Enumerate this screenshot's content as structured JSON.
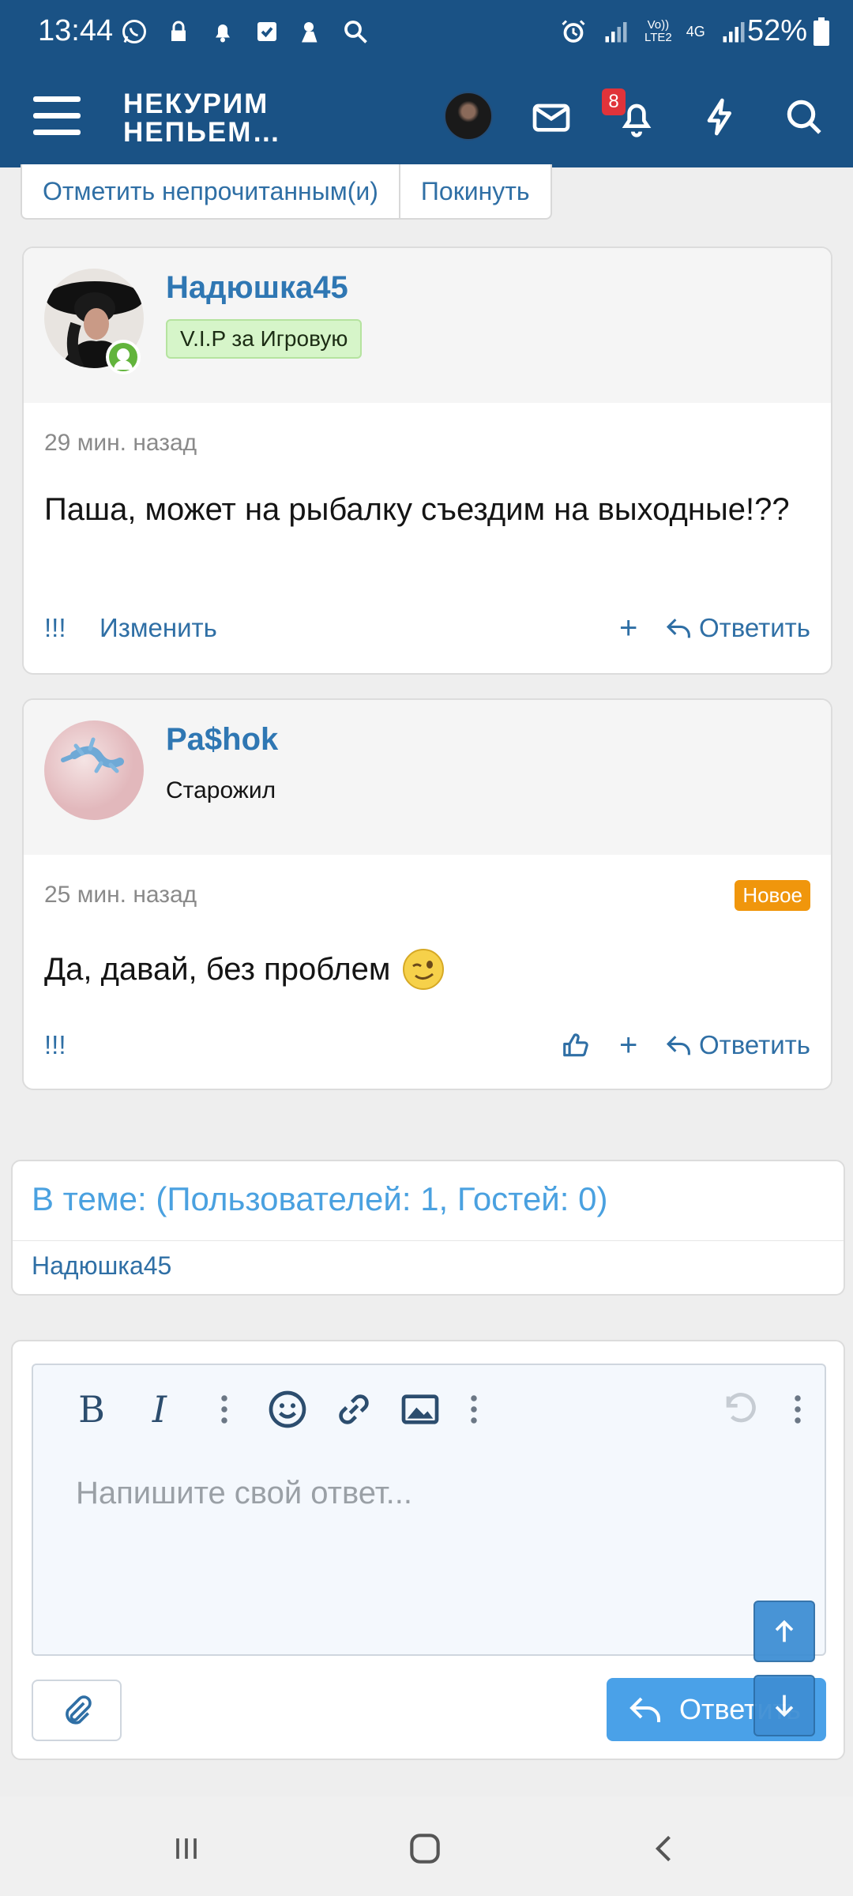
{
  "status_bar": {
    "time": "13:44",
    "network_label_1": "Vo))",
    "network_label_2": "LTE2",
    "network_label_3": "4G",
    "battery": "52%"
  },
  "app_bar": {
    "logo_line1": "НЕКУРИМ",
    "logo_line2": "НЕПЬЕМ…",
    "notification_count": "8"
  },
  "thread_actions": {
    "mark_unread": "Отметить непрочитанным(и)",
    "leave": "Покинуть"
  },
  "posts": [
    {
      "username": "Надюшка45",
      "user_title": "V.I.P за Игровую",
      "time": "29 мин. назад",
      "text": "Паша, может на рыбалку съездим на выходные!??",
      "footer": {
        "exclaim": "!!!",
        "edit": "Изменить",
        "plus": "+",
        "reply": "Ответить"
      }
    },
    {
      "username": "Pa$hok",
      "user_title": "Старожил",
      "time": "25 мин. назад",
      "new_label": "Новое",
      "text": "Да, давай, без проблем",
      "footer": {
        "exclaim": "!!!",
        "plus": "+",
        "reply": "Ответить"
      }
    }
  ],
  "in_topic": {
    "title": "В теме: (Пользователей: 1, Гостей: 0)",
    "user": "Надюшка45"
  },
  "reply_editor": {
    "placeholder": "Напишите свой ответ...",
    "submit_label": "Ответить"
  },
  "colors": {
    "header": "#1a5285",
    "link": "#2f6fa5",
    "accent": "#4aa1e8",
    "new_badge": "#f0960c",
    "notification_badge": "#e0333a",
    "online": "#62b43c"
  }
}
